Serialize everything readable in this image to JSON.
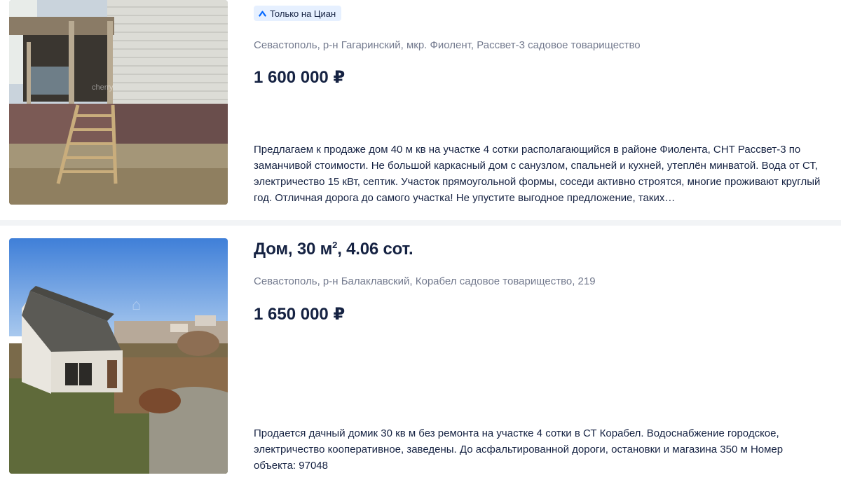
{
  "listings": [
    {
      "badge": "Только на Циан",
      "badge_icon": "cian-logo-icon",
      "address": "Севастополь, р-н Гагаринский, мкр. Фиолент, Рассвет-3 садовое товарищество",
      "price": "1 600 000 ₽",
      "description": "Предлагаем к продаже дом 40 м кв на участке 4 сотки располагающийся в районе Фиолента, СНТ Рассвет-3 по заманчивой стоимости. Не большой каркасный дом с санузлом, спальней и кухней, утеплён минватой. Вода от СТ, электричество 15 кВт, септик. Участок прямоугольной формы, соседи активно строятся, многие проживают круглый год. Отличная дорога до самого участка! Не упустите выгодное предложение, таких…",
      "photo_watermark": "cherry"
    },
    {
      "title_main": "Дом, 30 м",
      "title_sup": "2",
      "title_rest": ", 4.06 сот.",
      "address": "Севастополь, р-н Балаклавский, Корабел садовое товарищество, 219",
      "price": "1 650 000 ₽",
      "description": "Продается дачный домик 30 кв м без ремонта на участке 4 сотки в СТ Корабел. Водоснабжение городское, электричество кооперативное, заведены. До асфальтированной дороги, остановки и магазина 350 м Номер объекта: 97048"
    }
  ],
  "colors": {
    "accent": "#0468ff",
    "badge_bg": "#e6f0ff",
    "text": "#152242",
    "muted": "#737a8e",
    "page_bg": "#f2f4f6"
  }
}
